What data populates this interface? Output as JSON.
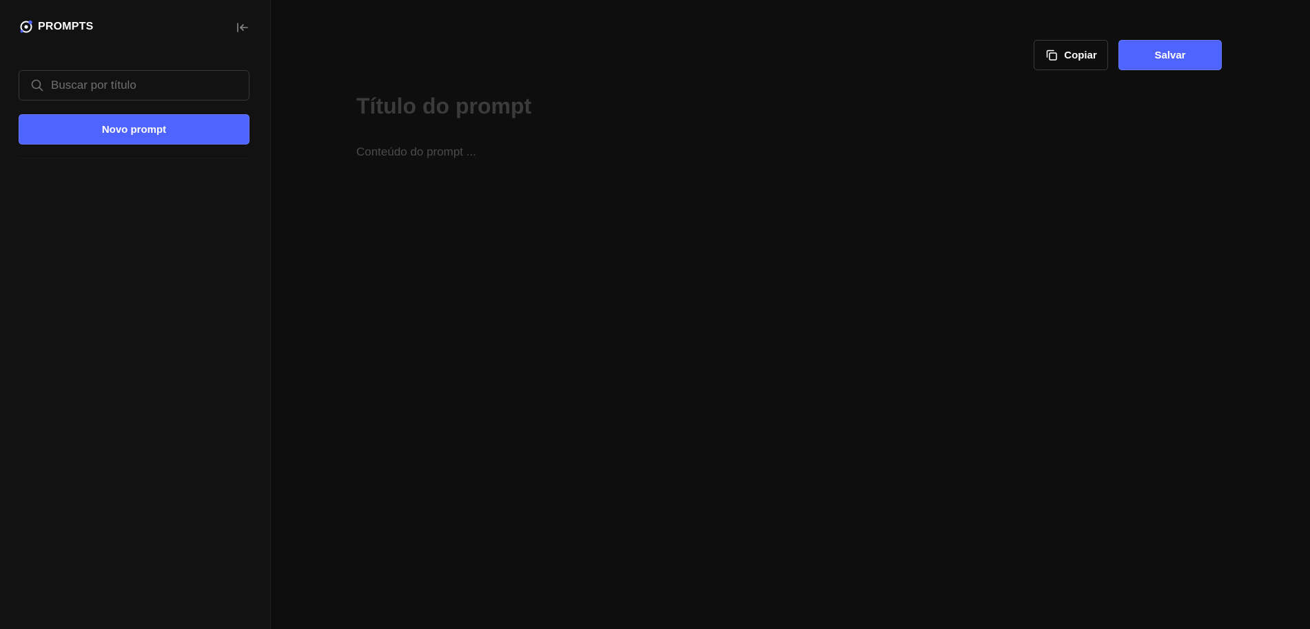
{
  "app": {
    "brand_name": "PROMPTS",
    "brand_icon": "prompts-logo-icon",
    "accent_color": "#4f63ff"
  },
  "sidebar": {
    "collapse_icon": "collapse-sidebar-icon",
    "search": {
      "placeholder": "Buscar por título",
      "value": "",
      "icon": "search-icon"
    },
    "new_prompt_label": "Novo prompt",
    "items": []
  },
  "editor": {
    "copy_label": "Copiar",
    "copy_icon": "copy-icon",
    "save_label": "Salvar",
    "title_placeholder": "Título do prompt",
    "title_value": "",
    "content_placeholder": "Conteúdo do prompt ...",
    "content_value": ""
  }
}
